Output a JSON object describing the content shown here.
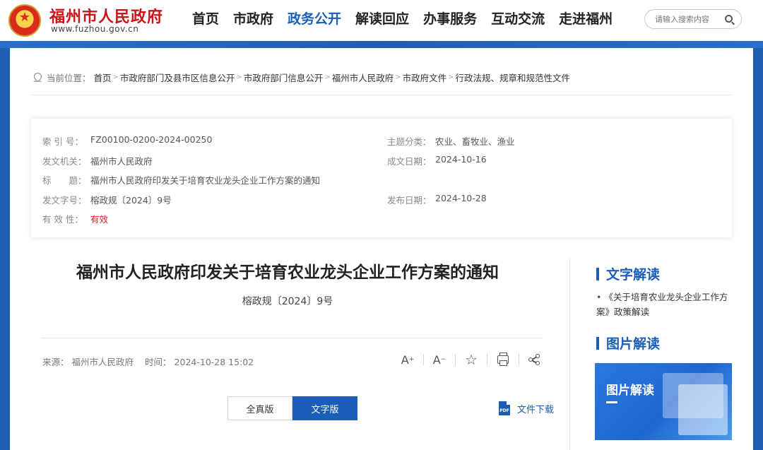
{
  "header": {
    "site_title": "福州市人民政府",
    "site_url": "www.fuzhou.gov.cn",
    "nav": [
      "首页",
      "市政府",
      "政务公开",
      "解读回应",
      "办事服务",
      "互动交流",
      "走进福州"
    ],
    "active_nav": "政务公开",
    "search_placeholder": "请输入搜索内容"
  },
  "breadcrumb": {
    "label": "当前位置：",
    "items": [
      "首页",
      "市政府部门及县市区信息公开",
      "市政府部门信息公开",
      "福州市人民政府",
      "市政府文件",
      "行政法规、规章和规范性文件"
    ]
  },
  "meta": {
    "index_key": "索 引 号：",
    "index_value": "FZ00100-0200-2024-00250",
    "topic_key": "主题分类：",
    "topic_value": "农业、畜牧业、渔业",
    "issuer_key": "发文机关：",
    "issuer_value": "福州市人民政府",
    "date_key": "成文日期：",
    "date_value": "2024-10-16",
    "title_key": "标　　题：",
    "title_value": "福州市人民政府印发关于培育农业龙头企业工作方案的通知",
    "docno_key": "发文字号：",
    "docno_value": "榕政规〔2024〕9号",
    "pubdate_key": "发布日期：",
    "pubdate_value": "2024-10-28",
    "valid_key": "有 效 性：",
    "valid_value": "有效"
  },
  "article": {
    "title": "福州市人民政府印发关于培育农业龙头企业工作方案的通知",
    "doc_no": "榕政规〔2024〕9号",
    "source_label": "来源：",
    "source": "福州市人民政府",
    "time_label": "时间：",
    "time": "2024-10-28 15:02",
    "tools": {
      "font_up": "A",
      "font_down": "A"
    },
    "tabs": [
      "全真版",
      "文字版"
    ],
    "active_tab": "文字版",
    "download": "文件下载",
    "pdf_label": "PDF"
  },
  "sidebar": {
    "text_heading": "文字解读",
    "text_item": "《关于培育农业龙头企业工作方案》政策解读",
    "pic_heading": "图片解读",
    "pic_caption": "图片解读"
  },
  "colors": {
    "brand_blue": "#1b5eb8",
    "title_red": "#c8141b",
    "valid_red": "#e02020"
  }
}
